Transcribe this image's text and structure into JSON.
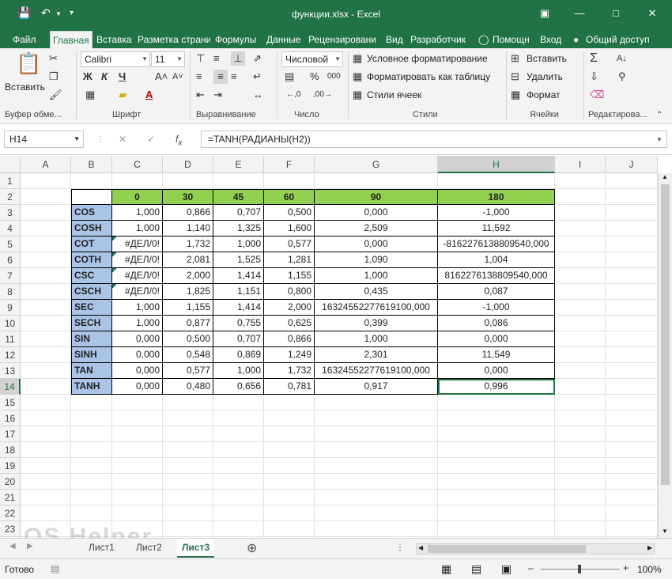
{
  "window": {
    "title": "функции.xlsx - Excel"
  },
  "ribbon_tabs": [
    "Файл",
    "Главная",
    "Вставка",
    "Разметка страни",
    "Формулы",
    "Данные",
    "Рецензировани",
    "Вид",
    "Разработчик"
  ],
  "tell_me": "Помощн",
  "sign_in": "Вход",
  "share": "Общий доступ",
  "ribbon": {
    "paste_label": "Вставить",
    "clipboard_label": "Буфер обме...",
    "font_name": "Calibri",
    "font_size": "11",
    "font_label": "Шрифт",
    "align_label": "Выравнивание",
    "number_format": "Числовой",
    "number_label": "Число",
    "cond_format": "Условное форматирование",
    "format_table": "Форматировать как таблицу",
    "cell_styles": "Стили ячеек",
    "styles_label": "Стили",
    "insert": "Вставить",
    "delete": "Удалить",
    "format": "Формат",
    "cells_label": "Ячейки",
    "editing_label": "Редактирова...",
    "bold": "Ж",
    "italic": "К",
    "underline": "Ч"
  },
  "formula_bar": {
    "name_box": "H14",
    "formula": "=TANH(РАДИАНЫ(H2))"
  },
  "columns": [
    "A",
    "B",
    "C",
    "D",
    "E",
    "F",
    "G",
    "H",
    "I",
    "J"
  ],
  "rows": [
    "1",
    "2",
    "3",
    "4",
    "5",
    "6",
    "7",
    "8",
    "9",
    "10",
    "11",
    "12",
    "13",
    "14",
    "15",
    "16",
    "17",
    "18",
    "19",
    "20",
    "21",
    "22",
    "23"
  ],
  "table": {
    "header": [
      "",
      "0",
      "30",
      "45",
      "60",
      "90",
      "180"
    ],
    "rows": [
      [
        "COS",
        "1,000",
        "0,866",
        "0,707",
        "0,500",
        "0,000",
        "-1,000"
      ],
      [
        "COSH",
        "1,000",
        "1,140",
        "1,325",
        "1,600",
        "2,509",
        "11,592"
      ],
      [
        "COT",
        "#ДЕЛ/0!",
        "1,732",
        "1,000",
        "0,577",
        "0,000",
        "-8162276138809540,000"
      ],
      [
        "COTH",
        "#ДЕЛ/0!",
        "2,081",
        "1,525",
        "1,281",
        "1,090",
        "1,004"
      ],
      [
        "CSC",
        "#ДЕЛ/0!",
        "2,000",
        "1,414",
        "1,155",
        "1,000",
        "8162276138809540,000"
      ],
      [
        "CSCH",
        "#ДЕЛ/0!",
        "1,825",
        "1,151",
        "0,800",
        "0,435",
        "0,087"
      ],
      [
        "SEC",
        "1,000",
        "1,155",
        "1,414",
        "2,000",
        "16324552277619100,000",
        "-1,000"
      ],
      [
        "SECH",
        "1,000",
        "0,877",
        "0,755",
        "0,625",
        "0,399",
        "0,086"
      ],
      [
        "SIN",
        "0,000",
        "0,500",
        "0,707",
        "0,866",
        "1,000",
        "0,000"
      ],
      [
        "SINH",
        "0,000",
        "0,548",
        "0,869",
        "1,249",
        "2,301",
        "11,549"
      ],
      [
        "TAN",
        "0,000",
        "0,577",
        "1,000",
        "1,732",
        "16324552277619100,000",
        "0,000"
      ],
      [
        "TANH",
        "0,000",
        "0,480",
        "0,656",
        "0,781",
        "0,917",
        "0,996"
      ]
    ]
  },
  "sheets": [
    "Лист1",
    "Лист2",
    "Лист3"
  ],
  "status": {
    "ready": "Готово",
    "zoom": "100%"
  },
  "watermark": "OS Helper",
  "colors": {
    "excel_green": "#217346",
    "label_blue": "#a9c4e6",
    "header_green": "#92d050"
  }
}
